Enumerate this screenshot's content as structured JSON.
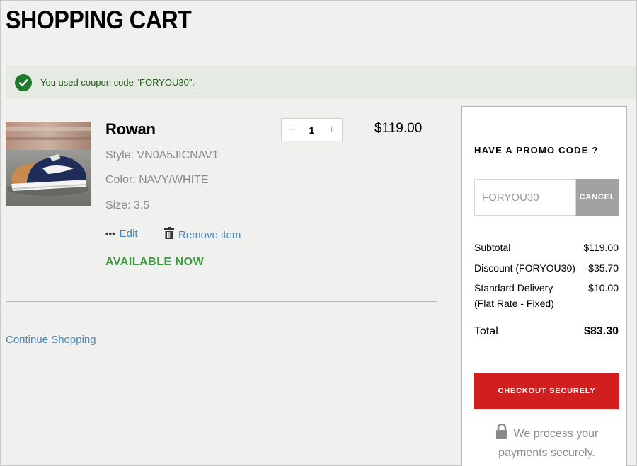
{
  "page": {
    "title": "SHOPPING CART"
  },
  "coupon_banner": {
    "message": "You used coupon code \"FORYOU30\"."
  },
  "cart_item": {
    "name": "Rowan",
    "style": "Style:  VN0A5JICNAV1",
    "color": "Color:  NAVY/WHITE",
    "size": "Size:  3.5",
    "quantity": "1",
    "qty_minus": "−",
    "qty_plus": "+",
    "price": "$119.00",
    "edit_label": "Edit",
    "remove_label": "Remove item",
    "availability": "AVAILABLE NOW"
  },
  "continue_label": "Continue Shopping",
  "summary": {
    "promo_title": "HAVE A PROMO CODE ?",
    "promo_value": "FORYOU30",
    "promo_cancel": "CANCEL",
    "subtotal_label": "Subtotal",
    "subtotal_value": "$119.00",
    "discount_label": "Discount (FORYOU30)",
    "discount_value": "-$35.70",
    "delivery_label": "Standard Delivery",
    "delivery_sub": "(Flat Rate - Fixed)",
    "delivery_value": "$10.00",
    "total_label": "Total",
    "total_value": "$83.30",
    "checkout_label": "CHECKOUT SECURELY",
    "secure_line1": "We process your",
    "secure_line2": "payments securely."
  },
  "colors": {
    "accent_red": "#d11e1e",
    "available_green": "#3f9a3f",
    "link_blue": "#4a86b8",
    "banner_bg": "#e5ebe2"
  },
  "icons": [
    "check-circle-icon",
    "product-image",
    "more-dots-icon",
    "trash-icon",
    "lock-icon"
  ]
}
